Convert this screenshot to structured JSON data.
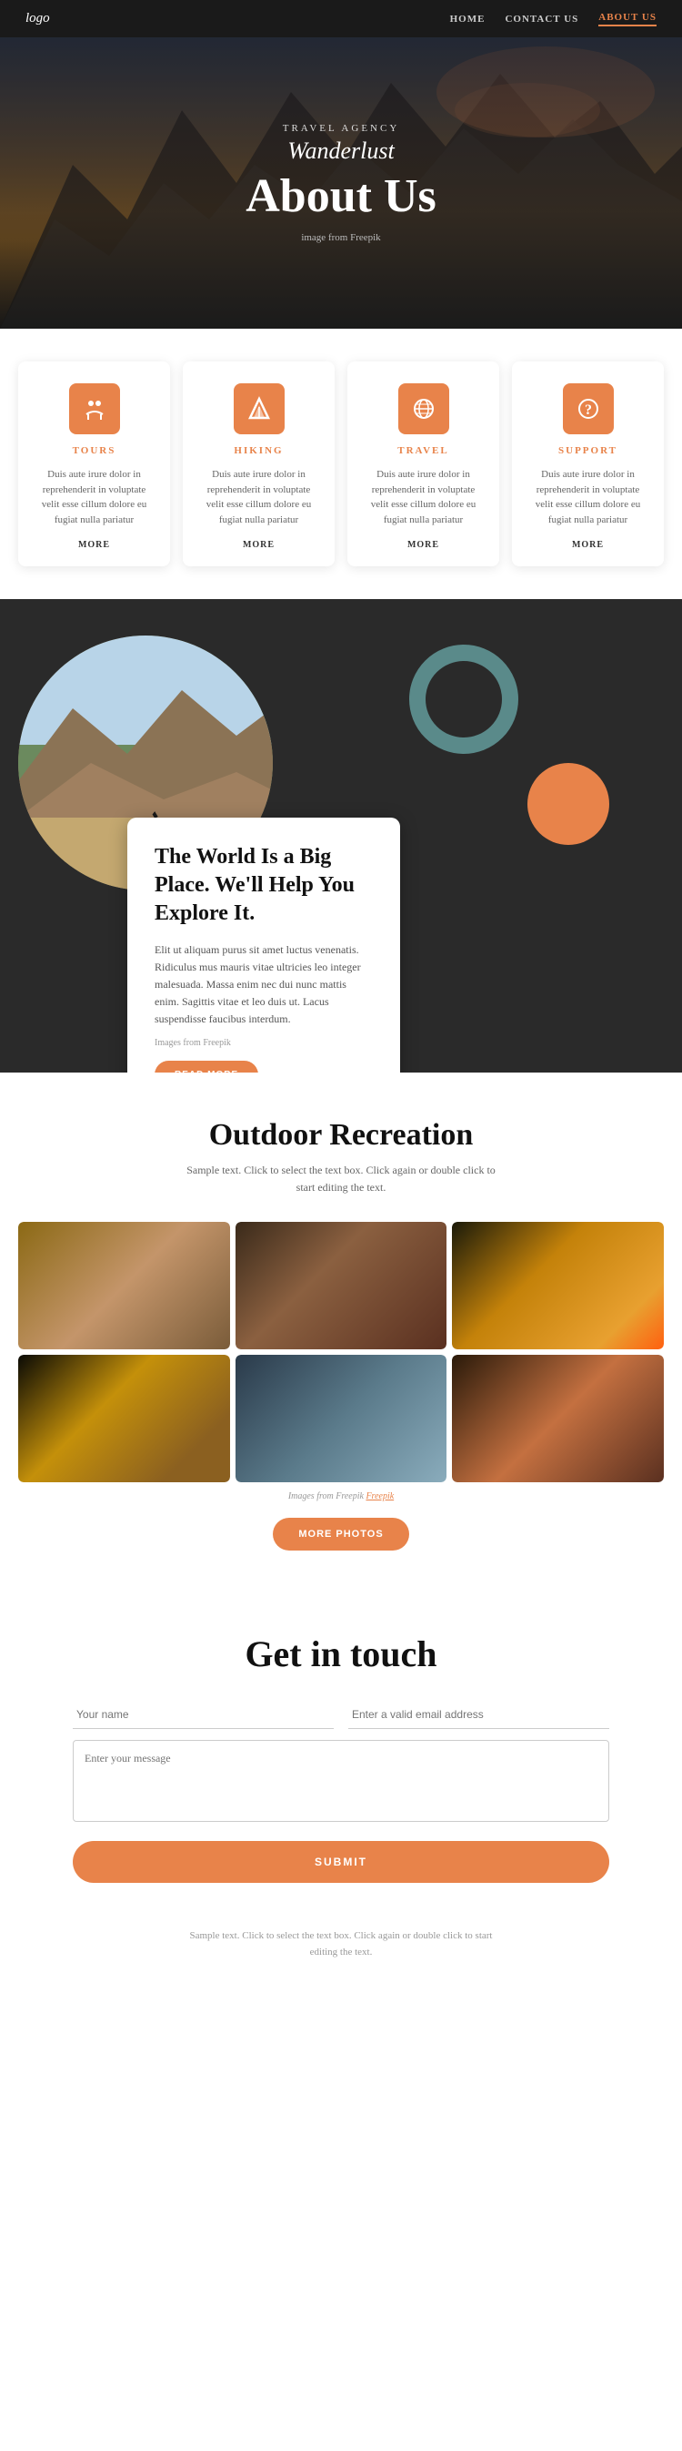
{
  "nav": {
    "logo": "logo",
    "links": [
      {
        "label": "HOME",
        "active": false
      },
      {
        "label": "CONTACT US",
        "active": false
      },
      {
        "label": "ABOUT US",
        "active": true
      }
    ]
  },
  "hero": {
    "agency": "TRAVEL AGENCY",
    "brand": "Wanderlust",
    "title": "About Us",
    "credit": "image from Freepik"
  },
  "services": [
    {
      "icon": "🧑‍🤝‍🧑",
      "title": "TOURS",
      "text": "Duis aute irure dolor in reprehenderit in voluptate velit esse cillum dolore eu fugiat nulla pariatur",
      "more": "MORE"
    },
    {
      "icon": "🏔️",
      "title": "HIKING",
      "text": "Duis aute irure dolor in reprehenderit in voluptate velit esse cillum dolore eu fugiat nulla pariatur",
      "more": "MORE"
    },
    {
      "icon": "✈️",
      "title": "TRAVEL",
      "text": "Duis aute irure dolor in reprehenderit in voluptate velit esse cillum dolore eu fugiat nulla pariatur",
      "more": "MORE"
    },
    {
      "icon": "❓",
      "title": "SUPPORT",
      "text": "Duis aute irure dolor in reprehenderit in voluptate velit esse cillum dolore eu fugiat nulla pariatur",
      "more": "MORE"
    }
  ],
  "explore": {
    "title": "The World Is a Big Place. We'll Help You Explore It.",
    "body": "Elit ut aliquam purus sit amet luctus venenatis. Ridiculus mus mauris vitae ultricies leo integer malesuada. Massa enim nec dui nunc mattis enim. Sagittis vitae et leo duis ut. Lacus suspendisse faucibus interdum.",
    "credit": "Images from Freepik",
    "button": "READ MORE"
  },
  "outdoor": {
    "title": "Outdoor Recreation",
    "subtitle": "Sample text. Click to select the text box. Click again or double click to start editing the text.",
    "credit": "Images from Freepik",
    "more_photos": "MORE PHOTOS"
  },
  "contact": {
    "title": "Get in touch",
    "name_placeholder": "Your name",
    "email_placeholder": "Enter a valid email address",
    "message_placeholder": "Enter your message",
    "submit": "SUBMIT"
  },
  "footer": {
    "text": "Sample text. Click to select the text box. Click again or double click to start editing the text."
  }
}
